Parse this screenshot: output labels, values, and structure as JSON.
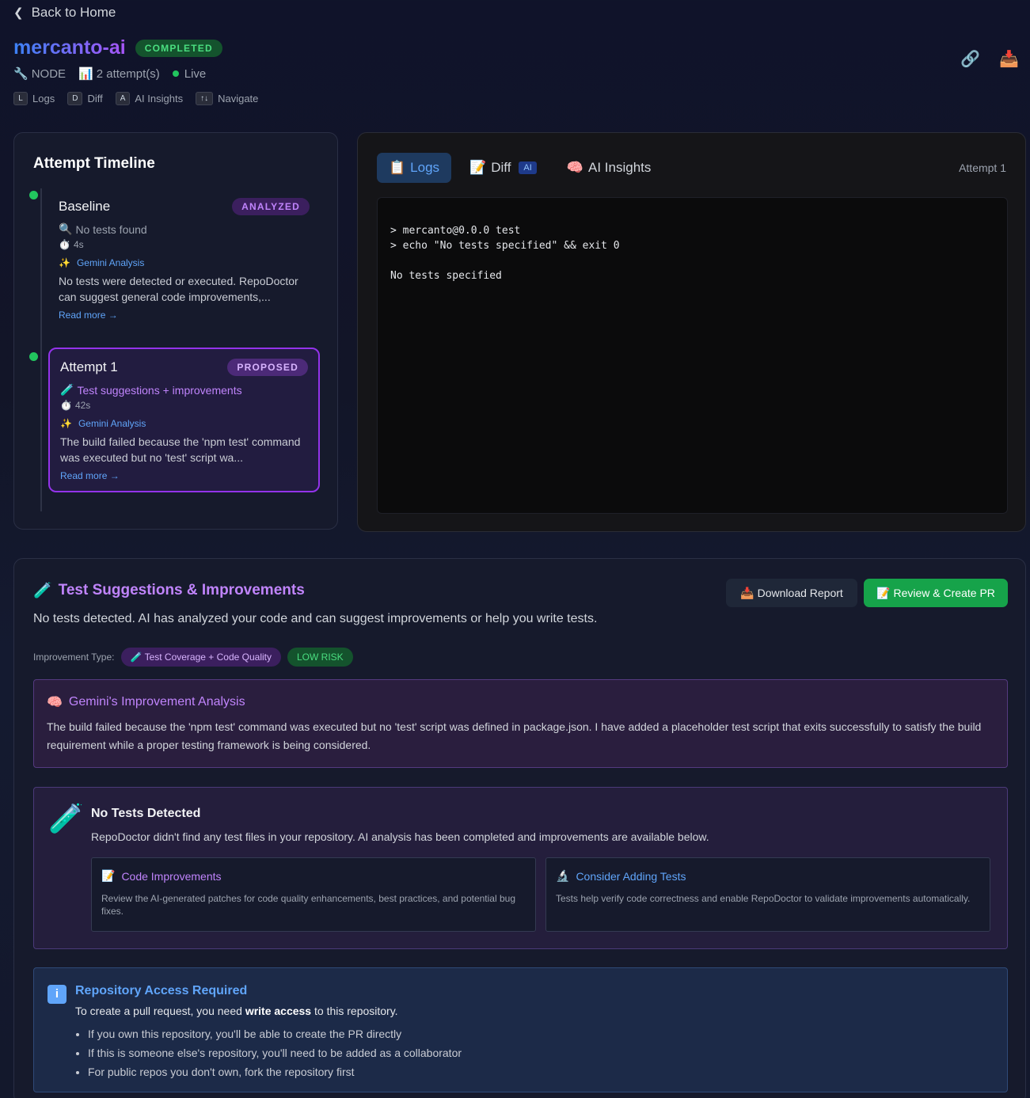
{
  "header": {
    "back_label": "Back to Home",
    "title": "mercanto-ai",
    "status_badge": "COMPLETED",
    "meta": {
      "runtime": "NODE",
      "attempts": "2 attempt(s)",
      "live": "Live"
    },
    "shortcuts": [
      {
        "key": "L",
        "label": "Logs"
      },
      {
        "key": "D",
        "label": "Diff"
      },
      {
        "key": "A",
        "label": "AI Insights"
      },
      {
        "key": "↑↓",
        "label": "Navigate"
      }
    ]
  },
  "timeline": {
    "title": "Attempt Timeline",
    "attempts": [
      {
        "name": "Baseline",
        "badge": "ANALYZED",
        "status": "No tests found",
        "duration": "4s",
        "analysis_label": "Gemini Analysis",
        "description": "No tests were detected or executed. RepoDoctor can suggest general code improvements,...",
        "read_more": "Read more →"
      },
      {
        "name": "Attempt 1",
        "badge": "PROPOSED",
        "status": "Test suggestions + improvements",
        "duration": "42s",
        "analysis_label": "Gemini Analysis",
        "description": "The build failed because the 'npm test' command was executed but no 'test' script wa...",
        "read_more": "Read more →"
      }
    ]
  },
  "logs_panel": {
    "tabs": {
      "logs": "Logs",
      "diff": "Diff",
      "diff_chip": "AI",
      "insights": "AI Insights"
    },
    "attempt_label": "Attempt 1",
    "lines": [
      "> mercanto@0.0.0 test",
      "> echo \"No tests specified\" && exit 0",
      "",
      "No tests specified"
    ]
  },
  "suggestions": {
    "title": "Test Suggestions & Improvements",
    "subtitle": "No tests detected. AI has analyzed your code and can suggest improvements or help you write tests.",
    "download_label": "Download Report",
    "pr_label": "Review & Create PR",
    "improvement_type_label": "Improvement Type:",
    "improvement_type": "Test Coverage + Code Quality",
    "risk": "LOW RISK",
    "analysis": {
      "title": "Gemini's Improvement Analysis",
      "text": "The build failed because the 'npm test' command was executed but no 'test' script was defined in package.json. I have added a placeholder test script that exits successfully to satisfy the build requirement while a proper testing framework is being considered."
    },
    "no_tests": {
      "title": "No Tests Detected",
      "text": "RepoDoctor didn't find any test files in your repository. AI analysis has been completed and improvements are available below.",
      "cards": [
        {
          "title": "Code Improvements",
          "text": "Review the AI-generated patches for code quality enhancements, best practices, and potential bug fixes."
        },
        {
          "title": "Consider Adding Tests",
          "text": "Tests help verify code correctness and enable RepoDoctor to validate improvements automatically."
        }
      ]
    },
    "access": {
      "title": "Repository Access Required",
      "text_before": "To create a pull request, you need ",
      "text_bold": "write access",
      "text_after": " to this repository.",
      "bullets": [
        "If you own this repository, you'll be able to create the PR directly",
        "If this is someone else's repository, you'll need to be added as a collaborator",
        "For public repos you don't own, fork the repository first"
      ]
    }
  },
  "colors": {
    "accent_purple": "#a855f7",
    "accent_blue": "#60a5fa",
    "success_green": "#22c55e"
  },
  "icons": [
    "chevron-left-icon",
    "wrench-icon",
    "bar-chart-icon",
    "link-icon",
    "inbox-tray-icon",
    "magnifier-icon",
    "stopwatch-icon",
    "sparkles-icon",
    "test-tube-icon",
    "clipboard-icon",
    "memo-icon",
    "brain-icon",
    "microscope-icon",
    "info-icon"
  ]
}
